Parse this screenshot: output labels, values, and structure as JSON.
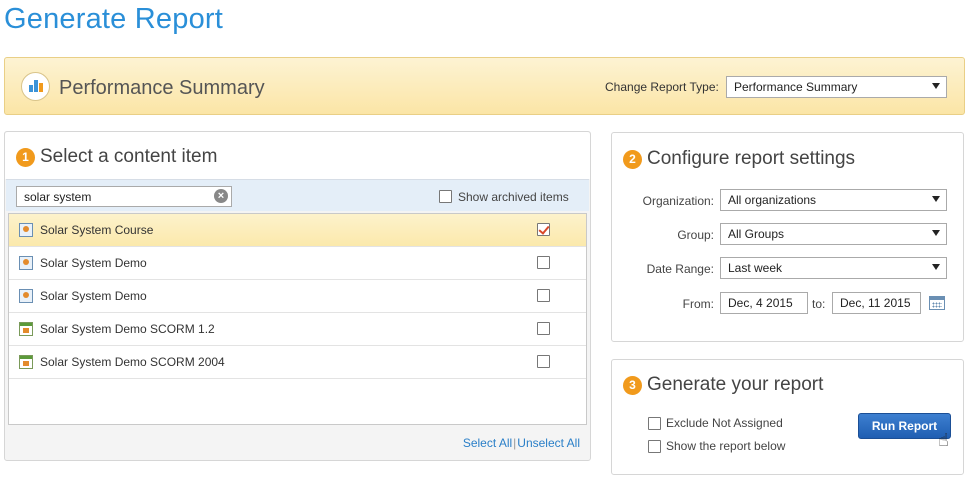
{
  "page": {
    "title": "Generate Report"
  },
  "banner": {
    "title": "Performance Summary",
    "type_label": "Change Report Type:",
    "type_value": "Performance Summary",
    "icon": "bar-chart-icon"
  },
  "content": {
    "step": "1",
    "title": "Select a content item",
    "search_value": "solar system",
    "show_archived_label": "Show archived items",
    "items": [
      {
        "name": "Solar System Course",
        "icon": "course-icon",
        "checked": true,
        "selected": true
      },
      {
        "name": "Solar System Demo",
        "icon": "course-icon",
        "checked": false,
        "selected": false
      },
      {
        "name": "Solar System Demo",
        "icon": "course-icon",
        "checked": false,
        "selected": false
      },
      {
        "name": "Solar System Demo SCORM 1.2",
        "icon": "scorm-icon",
        "checked": false,
        "selected": false
      },
      {
        "name": "Solar System Demo SCORM 2004",
        "icon": "scorm-icon",
        "checked": false,
        "selected": false
      }
    ],
    "select_all": "Select All",
    "separator": "|",
    "unselect_all": "Unselect All"
  },
  "settings": {
    "step": "2",
    "title": "Configure report settings",
    "organization_label": "Organization:",
    "organization_value": "All organizations",
    "group_label": "Group:",
    "group_value": "All Groups",
    "date_range_label": "Date Range:",
    "date_range_value": "Last week",
    "from_label": "From:",
    "from_value": "Dec, 4 2015",
    "to_label": "to:",
    "to_value": "Dec, 11 2015"
  },
  "generate": {
    "step": "3",
    "title": "Generate your report",
    "exclude_label": "Exclude Not Assigned",
    "show_below_label": "Show the report below",
    "run_button": "Run Report"
  },
  "colors": {
    "accent": "#2a8fd8",
    "step": "#f19a1c",
    "button": "#2a6cc2",
    "banner": "#fbe5a6"
  }
}
